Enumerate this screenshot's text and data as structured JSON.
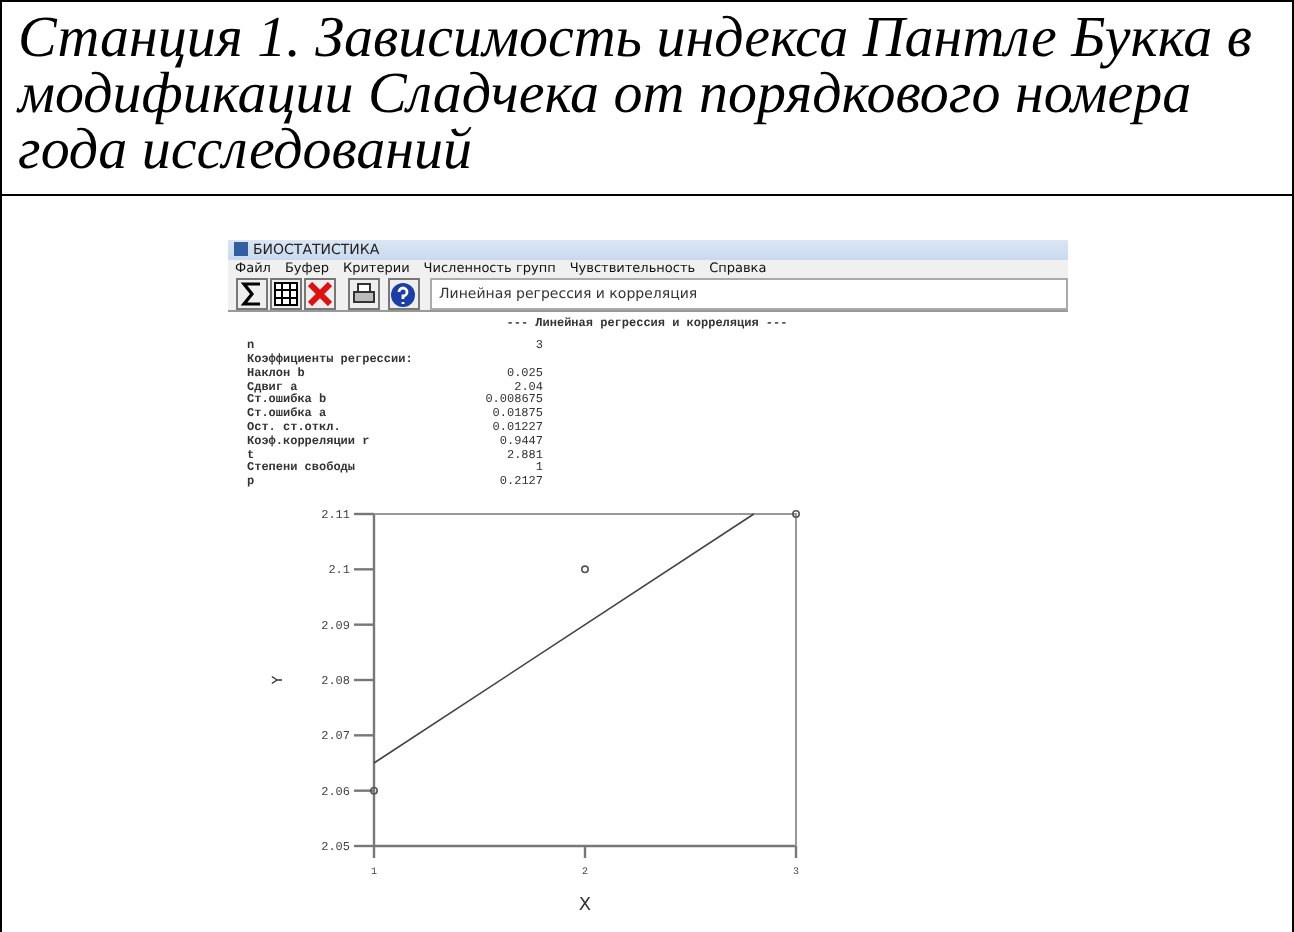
{
  "caption": "Станция 1. Зависимость индекса Пантле Букка в модификации Сладчека от порядкового номера года исследований",
  "window": {
    "title": "БИОСТАТИСТИКА",
    "menu": [
      "Файл",
      "Буфер",
      "Критерии",
      "Численность групп",
      "Чувствительность",
      "Справка"
    ],
    "toolbar_field": "Линейная регрессия и корреляция",
    "heading": "--- Линейная регрессия и корреляция ---",
    "stats": [
      {
        "label": "n",
        "value": "3"
      },
      {
        "label": "Коэффициенты регрессии:"
      },
      {
        "label": "Наклон b",
        "value": "0.025"
      },
      {
        "label": "Сдвиг a",
        "value": "2.04"
      },
      {
        "label": "Ст.ошибка b",
        "value": "0.008675"
      },
      {
        "label": "Ст.ошибка a",
        "value": "0.01875"
      },
      {
        "label": "Ост. ст.откл.",
        "value": "0.01227"
      },
      {
        "label": "Коэф.корреляции r",
        "value": "0.9447"
      },
      {
        "label": "t",
        "value": "2.881"
      },
      {
        "label": "Степени свободы",
        "value": "1"
      },
      {
        "label": "p",
        "value": "0.2127"
      }
    ],
    "chart_data": {
      "type": "scatter",
      "xlabel": "X",
      "ylabel": "Y",
      "x": [
        1,
        2,
        3
      ],
      "series": [
        {
          "color": "#555555",
          "values": [
            2.06,
            2.1,
            2.11
          ]
        },
        {
          "type": "line",
          "color": "#444444",
          "x": [
            1,
            2.8
          ],
          "values": [
            2.065,
            2.11
          ]
        }
      ],
      "xlim": [
        1,
        3
      ],
      "ylim": [
        2.05,
        2.11
      ],
      "xticks": [
        1,
        2,
        3
      ],
      "yticks": [
        {
          "value": 2.05,
          "label": "2.05"
        },
        {
          "value": 2.06,
          "label": "2.06"
        },
        {
          "value": 2.07,
          "label": "2.07"
        },
        {
          "value": 2.08,
          "label": "2.08"
        },
        {
          "value": 2.09,
          "label": "2.09"
        },
        {
          "value": 2.1,
          "label": "2.1"
        },
        {
          "value": 2.11,
          "label": "2.11"
        }
      ]
    }
  }
}
